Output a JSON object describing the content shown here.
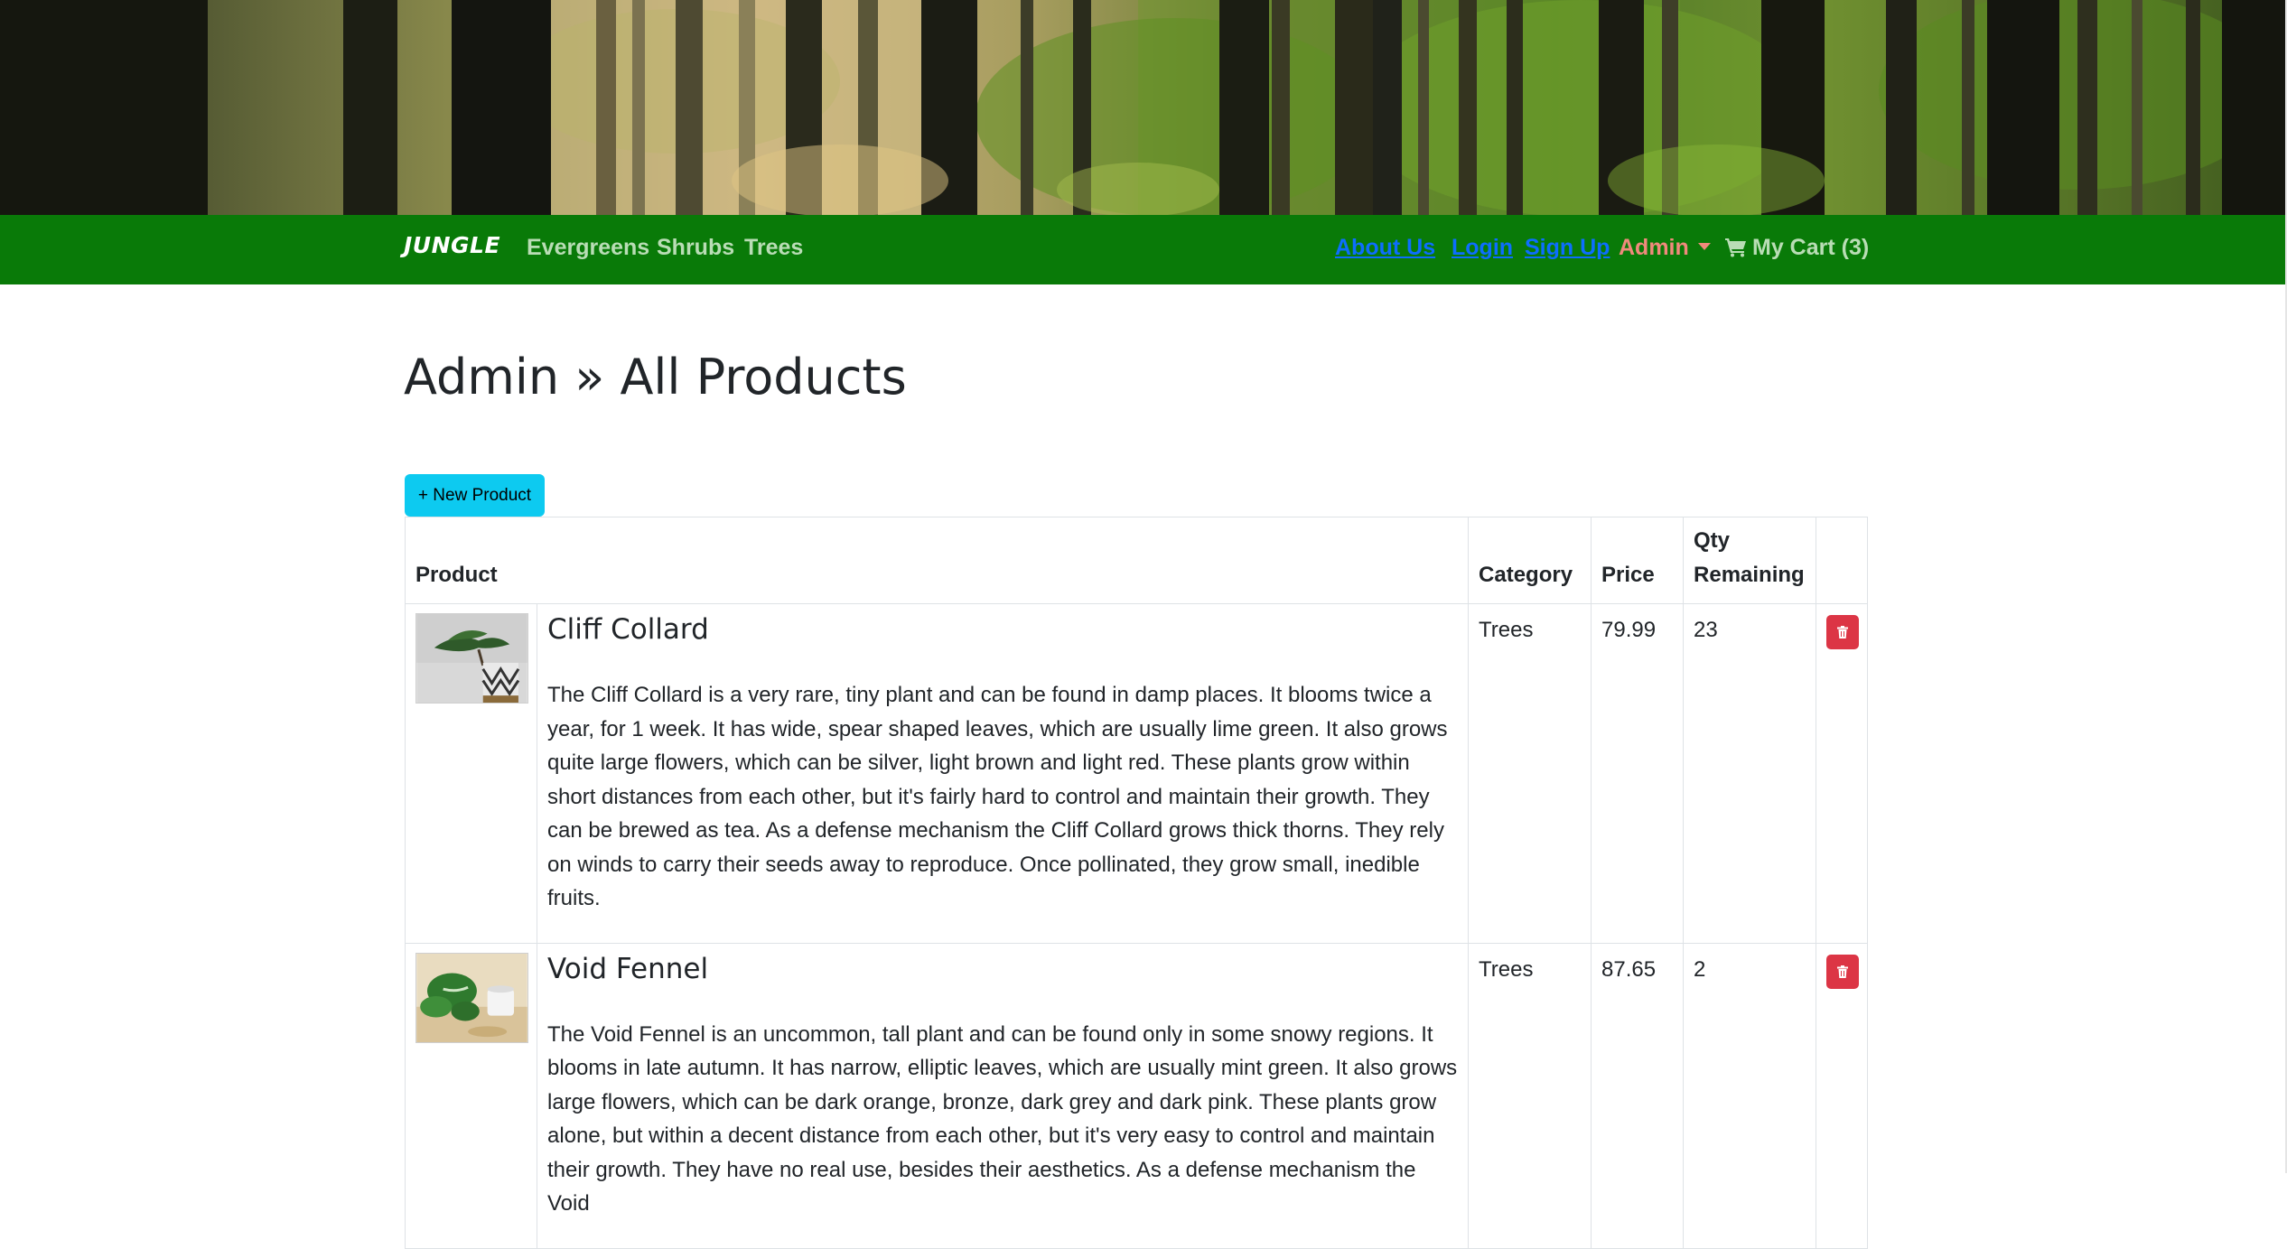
{
  "navbar": {
    "brand": "JUNGLE",
    "categories": [
      "Evergreens",
      "Shrubs",
      "Trees"
    ],
    "about": "About Us",
    "login": "Login",
    "signup": "Sign Up",
    "admin": "Admin",
    "cart": "My Cart (3)"
  },
  "page": {
    "title": "Admin » All Products",
    "new_product": "+ New Product"
  },
  "table": {
    "headers": [
      "Product",
      "Category",
      "Price",
      "Qty Remaining",
      ""
    ],
    "rows": [
      {
        "name": "Cliff Collard",
        "description": "The Cliff Collard is a very rare, tiny plant and can be found in damp places. It blooms twice a year, for 1 week. It has wide, spear shaped leaves, which are usually lime green. It also grows quite large flowers, which can be silver, light brown and light red. These plants grow within short distances from each other, but it's fairly hard to control and maintain their growth. They can be brewed as tea. As a defense mechanism the Cliff Collard grows thick thorns. They rely on winds to carry their seeds away to reproduce. Once pollinated, they grow small, inedible fruits.",
        "category": "Trees",
        "price": "79.99",
        "qty": "23"
      },
      {
        "name": "Void Fennel",
        "description": "The Void Fennel is an uncommon, tall plant and can be found only in some snowy regions. It blooms in late autumn. It has narrow, elliptic leaves, which are usually mint green. It also grows large flowers, which can be dark orange, bronze, dark grey and dark pink. These plants grow alone, but within a decent distance from each other, but it's very easy to control and maintain their growth. They have no real use, besides their aesthetics. As a defense mechanism the Void",
        "category": "Trees",
        "price": "87.65",
        "qty": "2"
      }
    ]
  },
  "colors": {
    "navbar_bg": "#097a08",
    "nav_link": "#b9ddb5",
    "link_blue": "#0d6efd",
    "admin_link": "#f08a7c",
    "info_button": "#0dcaf0",
    "danger_button": "#dc3545"
  },
  "icons": [
    "cart-icon",
    "trash-icon"
  ]
}
